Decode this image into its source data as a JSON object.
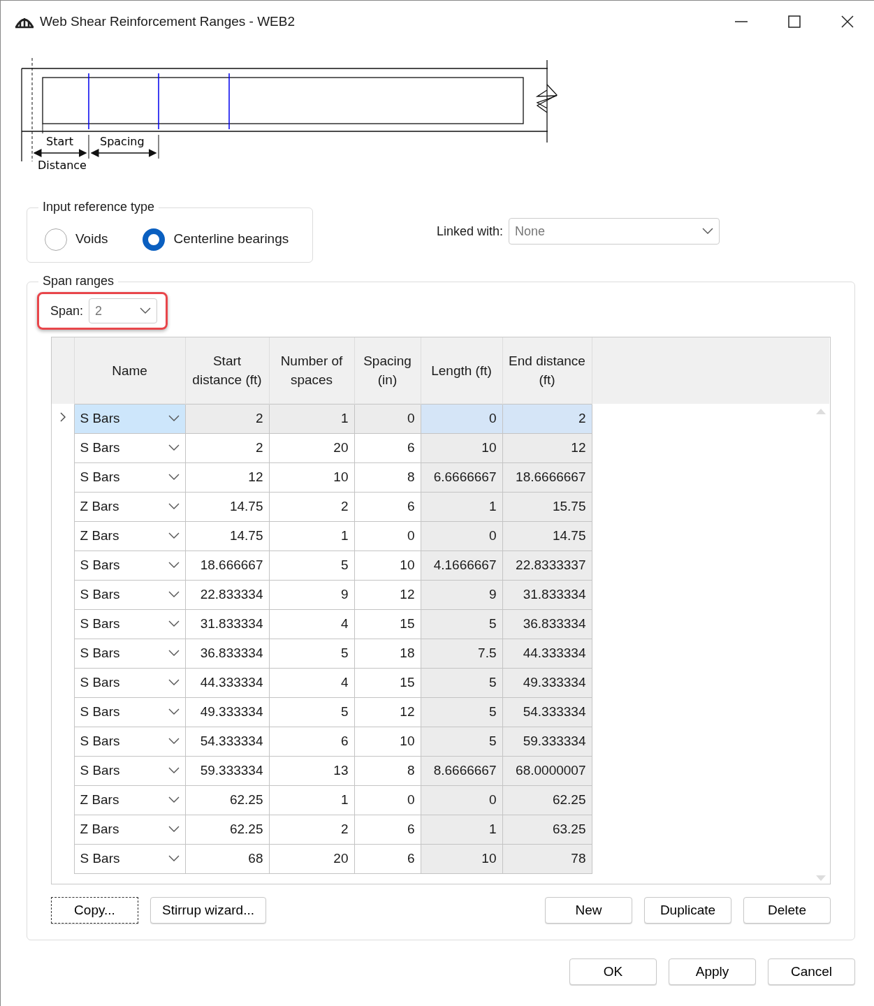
{
  "window": {
    "title": "Web Shear Reinforcement Ranges - WEB2"
  },
  "diagram": {
    "labels": [
      "Start",
      "Spacing",
      "Distance"
    ]
  },
  "input_reference_type": {
    "legend": "Input reference type",
    "options": [
      {
        "label": "Voids",
        "selected": false
      },
      {
        "label": "Centerline bearings",
        "selected": true
      }
    ]
  },
  "linked_with": {
    "label": "Linked with:",
    "value": "None"
  },
  "span_ranges": {
    "legend": "Span ranges",
    "span": {
      "label": "Span:",
      "value": "2",
      "highlighted": true
    },
    "columns": [
      "Name",
      "Start distance (ft)",
      "Number of spaces",
      "Spacing (in)",
      "Length (ft)",
      "End distance (ft)"
    ],
    "rows": [
      {
        "name": "S Bars",
        "start": "2",
        "spaces": "1",
        "spacing": "0",
        "length": "0",
        "end": "2",
        "selected": true
      },
      {
        "name": "S Bars",
        "start": "2",
        "spaces": "20",
        "spacing": "6",
        "length": "10",
        "end": "12",
        "selected": false
      },
      {
        "name": "S Bars",
        "start": "12",
        "spaces": "10",
        "spacing": "8",
        "length": "6.6666667",
        "end": "18.6666667",
        "selected": false
      },
      {
        "name": "Z Bars",
        "start": "14.75",
        "spaces": "2",
        "spacing": "6",
        "length": "1",
        "end": "15.75",
        "selected": false
      },
      {
        "name": "Z Bars",
        "start": "14.75",
        "spaces": "1",
        "spacing": "0",
        "length": "0",
        "end": "14.75",
        "selected": false
      },
      {
        "name": "S Bars",
        "start": "18.666667",
        "spaces": "5",
        "spacing": "10",
        "length": "4.1666667",
        "end": "22.8333337",
        "selected": false
      },
      {
        "name": "S Bars",
        "start": "22.833334",
        "spaces": "9",
        "spacing": "12",
        "length": "9",
        "end": "31.833334",
        "selected": false
      },
      {
        "name": "S Bars",
        "start": "31.833334",
        "spaces": "4",
        "spacing": "15",
        "length": "5",
        "end": "36.833334",
        "selected": false
      },
      {
        "name": "S Bars",
        "start": "36.833334",
        "spaces": "5",
        "spacing": "18",
        "length": "7.5",
        "end": "44.333334",
        "selected": false
      },
      {
        "name": "S Bars",
        "start": "44.333334",
        "spaces": "4",
        "spacing": "15",
        "length": "5",
        "end": "49.333334",
        "selected": false
      },
      {
        "name": "S Bars",
        "start": "49.333334",
        "spaces": "5",
        "spacing": "12",
        "length": "5",
        "end": "54.333334",
        "selected": false
      },
      {
        "name": "S Bars",
        "start": "54.333334",
        "spaces": "6",
        "spacing": "10",
        "length": "5",
        "end": "59.333334",
        "selected": false
      },
      {
        "name": "S Bars",
        "start": "59.333334",
        "spaces": "13",
        "spacing": "8",
        "length": "8.6666667",
        "end": "68.0000007",
        "selected": false
      },
      {
        "name": "Z Bars",
        "start": "62.25",
        "spaces": "1",
        "spacing": "0",
        "length": "0",
        "end": "62.25",
        "selected": false
      },
      {
        "name": "Z Bars",
        "start": "62.25",
        "spaces": "2",
        "spacing": "6",
        "length": "1",
        "end": "63.25",
        "selected": false
      },
      {
        "name": "S Bars",
        "start": "68",
        "spaces": "20",
        "spacing": "6",
        "length": "10",
        "end": "78",
        "selected": false
      }
    ],
    "left_buttons": [
      {
        "label": "Copy...",
        "focused": true
      },
      {
        "label": "Stirrup wizard...",
        "focused": false
      }
    ],
    "right_buttons": [
      {
        "label": "New",
        "focused": false
      },
      {
        "label": "Duplicate",
        "focused": false
      },
      {
        "label": "Delete",
        "focused": false
      }
    ]
  },
  "dialog_buttons": [
    {
      "label": "OK",
      "focused": false
    },
    {
      "label": "Apply",
      "focused": false
    },
    {
      "label": "Cancel",
      "focused": false
    }
  ]
}
